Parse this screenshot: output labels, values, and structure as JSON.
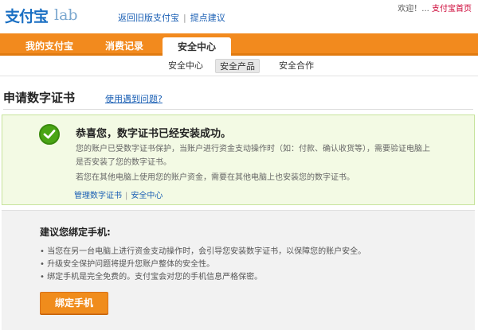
{
  "brand": {
    "name": "支付宝",
    "lab": "lab"
  },
  "top_links": [
    {
      "label": "返回旧版支付宝"
    },
    {
      "label": "提点建议"
    }
  ],
  "greeting": {
    "text": "欢迎！...",
    "badge": "支付宝首页"
  },
  "nav": {
    "tabs": [
      {
        "label": "我的支付宝"
      },
      {
        "label": "消费记录"
      },
      {
        "label": "安全中心"
      }
    ],
    "active_index": 2
  },
  "subnav": {
    "items": [
      {
        "label": "安全中心"
      },
      {
        "label": "安全产品"
      },
      {
        "label": "安全合作"
      }
    ],
    "active_index": 1
  },
  "page": {
    "title": "申请数字证书",
    "help_link": "使用遇到问题?"
  },
  "success": {
    "title": "恭喜您，数字证书已经安装成功。",
    "line1": "您的账户已受数字证书保护，当账户进行资金支动操作时（如：付款、确认收货等），需要验证电脑上",
    "line2": "是否安装了您的数字证书。",
    "line3": "若您在其他电脑上使用您的账户资金，需要在其他电脑上也安装您的数字证书。",
    "links": [
      {
        "label": "管理数字证书"
      },
      {
        "label": "安全中心"
      }
    ]
  },
  "suggest": {
    "title": "建议您绑定手机:",
    "bullets": [
      "• 当您在另一台电脑上进行资金支动操作时，会引导您安装数字证书，以保障您的账户安全。",
      "• 升级安全保护问题将提升您账户整体的安全性。",
      "• 绑定手机是完全免费的。支付宝会对您的手机信息严格保密。"
    ],
    "button": "绑定手机"
  }
}
